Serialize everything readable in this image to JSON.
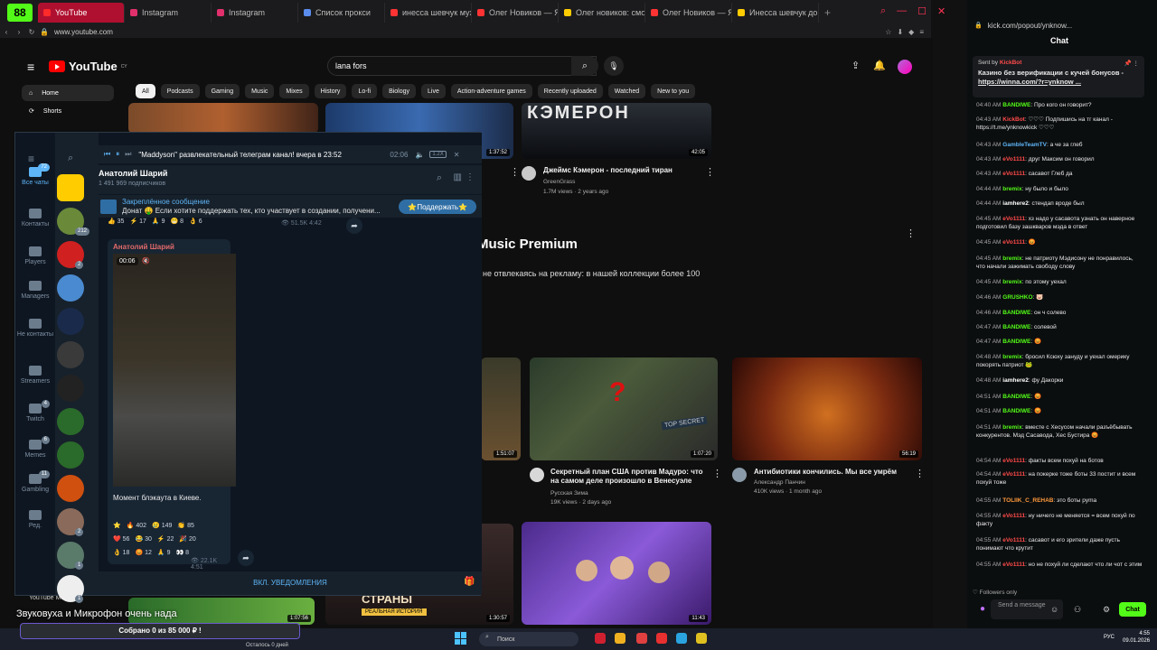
{
  "browser": {
    "logo": "88",
    "tabs": [
      {
        "label": "YouTube",
        "color": "#ff2a2a",
        "active": true
      },
      {
        "label": "Instagram",
        "color": "#e1306c"
      },
      {
        "label": "Instagram",
        "color": "#e1306c"
      },
      {
        "label": "Список прокси",
        "color": "#5b8def"
      },
      {
        "label": "инесса шевчук муж — Я...",
        "color": "#ff3333"
      },
      {
        "label": "Олег Новиков — Яндекс...",
        "color": "#ff3333"
      },
      {
        "label": "Олег новиков: смотрите...",
        "color": "#ffcc00"
      },
      {
        "label": "Олег Новиков — Яндекс...",
        "color": "#ff3333"
      },
      {
        "label": "Инесса шевчук до и после...",
        "color": "#ffcc00"
      }
    ],
    "url": "www.youtube.com"
  },
  "youtube": {
    "logo_text": "YouTube",
    "logo_region": "CY",
    "search_value": "lana fors",
    "sidebar": [
      {
        "label": "Home",
        "icon": "home-icon"
      },
      {
        "label": "Shorts",
        "icon": "shorts-icon"
      }
    ],
    "chips": [
      "All",
      "Podcasts",
      "Gaming",
      "Music",
      "Mixes",
      "History",
      "Lo-fi",
      "Biology",
      "Live",
      "Action-adventure games",
      "Recently uploaded",
      "Watched",
      "New to you"
    ],
    "top_videos": [
      {
        "title": "Джеймс Кэмерон - последний тиран",
        "channel": "GreenGrass",
        "meta": "1.7M views · 2 years ago",
        "duration": "42:05"
      },
      {
        "duration": "1:37:52"
      }
    ],
    "premium_title": "Music Premium",
    "premium_desc": "не отвлекаясь на рекламу: в нашей коллекции более 100",
    "grid_videos": [
      {
        "title": "Секретный план США против Мадуро: что на самом деле произошло в Венесуэле",
        "channel": "Русская Зима",
        "meta": "19K views · 2 days ago",
        "duration": "1:07:20"
      },
      {
        "title": "Антибиотики кончились. Мы все умрём",
        "channel": "Александр Панчин",
        "meta": "410K views · 1 month ago",
        "duration": "56:19"
      },
      {
        "duration": "1:51:07"
      }
    ],
    "bottom_durations": [
      "1:07:56",
      "1:30:57",
      "11:43"
    ],
    "bottom_texts": [
      "СТРАНЫ",
      "РЕАЛЬНАЯ ИСТОРИЯ"
    ],
    "overlay_caption": "Звуковуха и Микрофон очень нада",
    "yt_music": "YouTube Music"
  },
  "telegram": {
    "folders": [
      {
        "label": "Все чаты",
        "badge": "72"
      },
      {
        "label": "Контакты"
      },
      {
        "label": "Players"
      },
      {
        "label": "Managers"
      },
      {
        "label": "Не контакты"
      },
      {
        "label": "Streamers"
      },
      {
        "label": "Twitch",
        "badge": "4"
      },
      {
        "label": "Memes",
        "badge": "6"
      },
      {
        "label": "Gambling",
        "badge": "11"
      },
      {
        "label": "Ред."
      }
    ],
    "chat_badges": [
      "212",
      "2",
      "2",
      "1",
      "1"
    ],
    "player_title": "\"Maddyson\" развлекательный телеграм канал! вчера в 23:52",
    "player_time": "02:06",
    "player_speed": "1.2X",
    "channel_name": "Анатолий Шарий",
    "subscribers": "1 491 969 подписчиков",
    "pinned_label": "Закреплённое сообщение",
    "pinned_text": "Донат 🤑 Если хотите поддержать тех, кто участвует в создании, получени...",
    "support_btn": "⭐Поддержать⭐",
    "prev_reactions": [
      "👍 35",
      "⚡ 17",
      "🙏 9",
      "😁 8",
      "👌 6"
    ],
    "prev_views": "51.5K",
    "prev_time": "4:42",
    "msg_author": "Анатолий Шарий",
    "video_time": "00:06",
    "msg_text": "Момент блэкаута в Киеве.",
    "reactions_row1": [
      "⭐",
      "🔥 402",
      "😢 149",
      "👏 85"
    ],
    "reactions_row2": [
      "❤️ 56",
      "😂 30",
      "⚡ 22",
      "🎉 20"
    ],
    "reactions_row3": [
      "👌 18",
      "😡 12",
      "🙏 9",
      "👀 8"
    ],
    "msg_views": "22.1K",
    "msg_time": "4:51",
    "unmute_btn": "ВКЛ. УВЕДОМЛЕНИЯ"
  },
  "kick": {
    "url": "kick.com/popout/ynknow...",
    "title": "Chat",
    "pinned_by": "Sent by",
    "pinned_user": "KickBot",
    "pinned_text": "Казино без верификации с кучей бонусов - ",
    "pinned_link": "https://winna.com/?r=ynknow ...",
    "messages": [
      {
        "t": "04:40 AM",
        "u": "BANDIWE",
        "c": "#53fc18",
        "m": "Про кого он говорит?"
      },
      {
        "t": "04:43 AM",
        "u": "KickBot",
        "c": "#ff4a4a",
        "m": "♡♡♡ Подпишись на тг канал - https://t.me/ynknowkick ♡♡♡"
      },
      {
        "t": "04:43 AM",
        "u": "GambleTeamTV",
        "c": "#5eb5f7",
        "m": "а че за глеб"
      },
      {
        "t": "04:43 AM",
        "u": "eVo1111",
        "c": "#ff4a4a",
        "m": "друг Максим он говорил"
      },
      {
        "t": "04:43 AM",
        "u": "eVo1111",
        "c": "#ff4a4a",
        "m": "сасавот Глеб да"
      },
      {
        "t": "04:44 AM",
        "u": "bremix",
        "c": "#53fc18",
        "m": "ну было и было"
      },
      {
        "t": "04:44 AM",
        "u": "iamhere2",
        "c": "#ffffff",
        "m": "стендап вроде был"
      },
      {
        "t": "04:45 AM",
        "u": "eVo1111",
        "c": "#ff4a4a",
        "m": "хз надо у сасавота узнать он наверное подготовил базу зашкваров мэда в ответ"
      },
      {
        "t": "04:45 AM",
        "u": "eVo1111",
        "c": "#ff4a4a",
        "m": "😡"
      },
      {
        "t": "04:45 AM",
        "u": "bremix",
        "c": "#53fc18",
        "m": "не патриоту Мэдисону не понравилось, что начали зажимать свободу слову"
      },
      {
        "t": "04:45 AM",
        "u": "bremix",
        "c": "#53fc18",
        "m": "по этому уехал"
      },
      {
        "t": "04:46 AM",
        "u": "GRUSHKO",
        "c": "#53fc18",
        "m": "🐷"
      },
      {
        "t": "04:46 AM",
        "u": "BANDIWE",
        "c": "#53fc18",
        "m": "он ч солево"
      },
      {
        "t": "04:47 AM",
        "u": "BANDIWE",
        "c": "#53fc18",
        "m": "солевой"
      },
      {
        "t": "04:47 AM",
        "u": "BANDIWE",
        "c": "#53fc18",
        "m": "😡"
      },
      {
        "t": "04:48 AM",
        "u": "bremix",
        "c": "#53fc18",
        "m": "бросил Ксюху зануду и уехал омерику покорять патриот 🐸"
      },
      {
        "t": "04:48 AM",
        "u": "iamhere2",
        "c": "#ffffff",
        "m": "фу Дакорки"
      },
      {
        "t": "04:51 AM",
        "u": "BANDIWE",
        "c": "#53fc18",
        "m": "😡"
      },
      {
        "t": "04:51 AM",
        "u": "BANDIWE",
        "c": "#53fc18",
        "m": "😡"
      },
      {
        "t": "04:51 AM",
        "u": "bremix",
        "c": "#53fc18",
        "m": "вместе с Хесусом начали разъёбывать конкурентов. Мэд Сасавода, Хес Бустира 😡"
      },
      {
        "t": "04:54 AM",
        "u": "eVo1111",
        "c": "#ff4a4a",
        "m": "факты всем похуй на ботов"
      },
      {
        "t": "04:54 AM",
        "u": "eVo1111",
        "c": "#ff4a4a",
        "m": "на покерке тоже боты 33 постит и всем похуй тоже"
      },
      {
        "t": "04:55 AM",
        "u": "TOLIIK_C_REHAB",
        "c": "#ff9a3c",
        "m": "это боты руma"
      },
      {
        "t": "04:55 AM",
        "u": "eVo1111",
        "c": "#ff4a4a",
        "m": "ну ничего не меняется = всем похуй по факту"
      },
      {
        "t": "04:55 AM",
        "u": "eVo1111",
        "c": "#ff4a4a",
        "m": "сасавот и его зрители даже пусть понимают что крутит"
      },
      {
        "t": "04:55 AM",
        "u": "eVo1111",
        "c": "#ff4a4a",
        "m": "но не похуй ли сделают что ли чот с этим"
      }
    ],
    "followers_only": "Followers only",
    "input_placeholder": "Send a message",
    "chat_btn": "Chat"
  },
  "taskbar": {
    "donation": "Собрано 0 из 85 000 ₽ !",
    "search": "Поиск",
    "lang": "РУС",
    "time": "4:55",
    "date": "09.01.2026",
    "stream_caption": "Осталось 0 дней"
  }
}
